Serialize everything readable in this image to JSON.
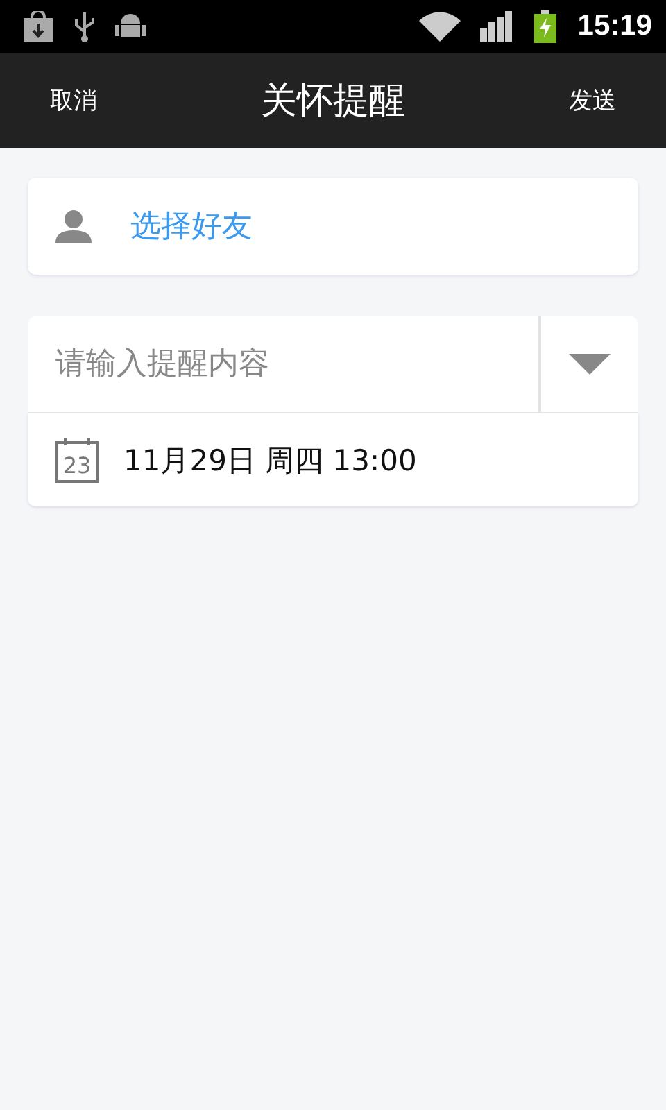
{
  "status_bar": {
    "time": "15:19"
  },
  "title_bar": {
    "cancel": "取消",
    "title": "关怀提醒",
    "send": "发送"
  },
  "friend_picker": {
    "label": "选择好友"
  },
  "reminder": {
    "placeholder": "请输入提醒内容",
    "calendar_day": "23",
    "datetime": "11月29日 周四 13:00"
  }
}
